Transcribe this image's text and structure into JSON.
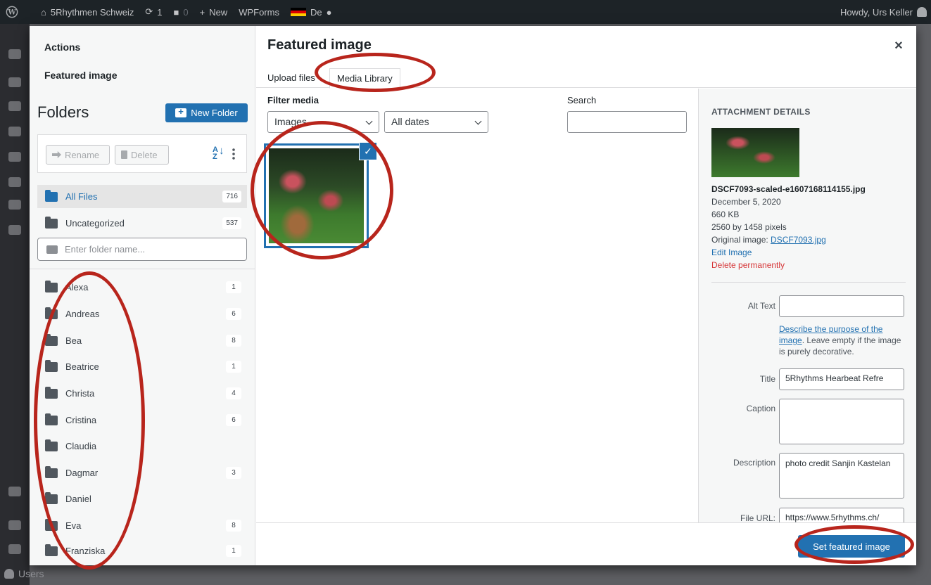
{
  "admin_bar": {
    "site_name": "5Rhythmen Schweiz",
    "updates_count": "1",
    "comments_count": "0",
    "new_label": "New",
    "wpforms_label": "WPForms",
    "lang_label": "De",
    "howdy": "Howdy, Urs Keller"
  },
  "admin_menu": {
    "users_label": "Users"
  },
  "sidebar": {
    "actions_label": "Actions",
    "featured_image_label": "Featured image",
    "folders_title": "Folders",
    "new_folder_label": "New Folder",
    "rename_label": "Rename",
    "delete_label": "Delete",
    "sort_label": "A↓Z",
    "all_files": {
      "label": "All Files",
      "count": "716"
    },
    "uncategorized": {
      "label": "Uncategorized",
      "count": "537"
    },
    "folder_search_placeholder": "Enter folder name...",
    "folders": [
      {
        "label": "Alexa",
        "count": "1"
      },
      {
        "label": "Andreas",
        "count": "6"
      },
      {
        "label": "Bea",
        "count": "8"
      },
      {
        "label": "Beatrice",
        "count": "1"
      },
      {
        "label": "Christa",
        "count": "4"
      },
      {
        "label": "Cristina",
        "count": "6"
      },
      {
        "label": "Claudia",
        "count": ""
      },
      {
        "label": "Dagmar",
        "count": "3"
      },
      {
        "label": "Daniel",
        "count": ""
      },
      {
        "label": "Eva",
        "count": "8"
      },
      {
        "label": "Franziska",
        "count": "1"
      }
    ]
  },
  "main": {
    "title": "Featured image",
    "close_symbol": "×",
    "tabs": [
      {
        "label": "Upload files"
      },
      {
        "label": "Media Library"
      }
    ],
    "filter_label": "Filter media",
    "search_label": "Search",
    "type_select": "Images",
    "date_select": "All dates",
    "check_symbol": "✓"
  },
  "details": {
    "heading": "ATTACHMENT DETAILS",
    "filename": "DSCF7093-scaled-e1607168114155.jpg",
    "date": "December 5, 2020",
    "size": "660 KB",
    "dimensions": "2560 by 1458 pixels",
    "original_prefix": "Original image: ",
    "original_link": "DSCF7093.jpg",
    "edit_image": "Edit Image",
    "delete_permanently": "Delete permanently",
    "alt_text_label": "Alt Text",
    "alt_text_value": "",
    "alt_help_link": "Describe the purpose of the image",
    "alt_help_rest": ". Leave empty if the image is purely decorative.",
    "title_label": "Title",
    "title_value": "5Rhythms Hearbeat Refre",
    "caption_label": "Caption",
    "caption_value": "",
    "description_label": "Description",
    "description_value": "photo credit Sanjin Kastelan",
    "file_url_label": "File URL:",
    "file_url_value": "https://www.5rhythms.ch/"
  },
  "footer": {
    "set_button": "Set featured image"
  },
  "colors": {
    "accent": "#2271b1",
    "danger": "#d63638",
    "annotation": "#b8251c"
  }
}
